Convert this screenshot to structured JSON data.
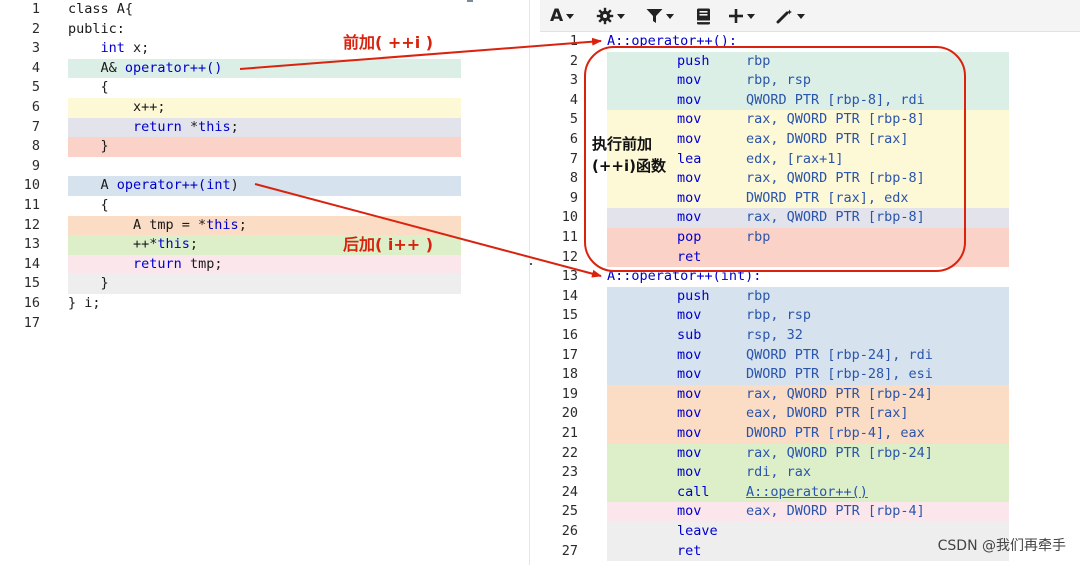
{
  "source": {
    "lines": [
      {
        "n": "1",
        "band": "",
        "segs": [
          {
            "t": "class A{",
            "kw": false
          }
        ]
      },
      {
        "n": "2",
        "band": "",
        "segs": [
          {
            "t": "public:",
            "kw": false
          }
        ]
      },
      {
        "n": "3",
        "band": "",
        "segs": [
          {
            "t": "    ",
            "kw": false
          },
          {
            "t": "int",
            "kw": true
          },
          {
            "t": " x;",
            "kw": false
          }
        ]
      },
      {
        "n": "4",
        "band": "#dcefe6",
        "segs": [
          {
            "t": "    A& ",
            "kw": false
          },
          {
            "t": "operator++()",
            "kw": true
          }
        ]
      },
      {
        "n": "5",
        "band": "",
        "segs": [
          {
            "t": "    {",
            "kw": false
          }
        ]
      },
      {
        "n": "6",
        "band": "#fdf8d6",
        "segs": [
          {
            "t": "        x++;",
            "kw": false
          }
        ]
      },
      {
        "n": "7",
        "band": "#e3e3ec",
        "segs": [
          {
            "t": "        ",
            "kw": false
          },
          {
            "t": "return",
            "kw": true
          },
          {
            "t": " *",
            "kw": false
          },
          {
            "t": "this",
            "kw": true
          },
          {
            "t": ";",
            "kw": false
          }
        ]
      },
      {
        "n": "8",
        "band": "#fbd2c8",
        "segs": [
          {
            "t": "    }",
            "kw": false
          }
        ]
      },
      {
        "n": "9",
        "band": "",
        "segs": []
      },
      {
        "n": "10",
        "band": "#d6e2ee",
        "segs": [
          {
            "t": "    A ",
            "kw": false
          },
          {
            "t": "operator++(",
            "kw": true
          },
          {
            "t": "int",
            "kw": true
          },
          {
            "t": ")",
            "kw": false
          }
        ]
      },
      {
        "n": "11",
        "band": "",
        "segs": [
          {
            "t": "    {",
            "kw": false
          }
        ]
      },
      {
        "n": "12",
        "band": "#fbdcc4",
        "segs": [
          {
            "t": "        A tmp = *",
            "kw": false
          },
          {
            "t": "this",
            "kw": true
          },
          {
            "t": ";",
            "kw": false
          }
        ]
      },
      {
        "n": "13",
        "band": "#dcefc9",
        "segs": [
          {
            "t": "        ++*",
            "kw": false
          },
          {
            "t": "this",
            "kw": true
          },
          {
            "t": ";",
            "kw": false
          }
        ]
      },
      {
        "n": "14",
        "band": "#fbe6ec",
        "segs": [
          {
            "t": "        ",
            "kw": false
          },
          {
            "t": "return",
            "kw": true
          },
          {
            "t": " tmp;",
            "kw": false
          }
        ]
      },
      {
        "n": "15",
        "band": "#eeeeee",
        "segs": [
          {
            "t": "    }",
            "kw": false
          }
        ]
      },
      {
        "n": "16",
        "band": "",
        "segs": [
          {
            "t": "} i;",
            "kw": false
          }
        ]
      },
      {
        "n": "17",
        "band": "",
        "segs": []
      }
    ]
  },
  "toolbar": {
    "font_label": "A"
  },
  "assembly": {
    "lines": [
      {
        "n": "1",
        "band": "",
        "label": "A::operator++():",
        "op": "",
        "arg": ""
      },
      {
        "n": "2",
        "band": "#dcefe6",
        "label": "",
        "op": "push",
        "arg": "rbp"
      },
      {
        "n": "3",
        "band": "#dcefe6",
        "label": "",
        "op": "mov",
        "arg": "rbp, rsp"
      },
      {
        "n": "4",
        "band": "#dcefe6",
        "label": "",
        "op": "mov",
        "arg": "QWORD PTR [rbp-8], rdi"
      },
      {
        "n": "5",
        "band": "#fdf8d6",
        "label": "",
        "op": "mov",
        "arg": "rax, QWORD PTR [rbp-8]"
      },
      {
        "n": "6",
        "band": "#fdf8d6",
        "label": "",
        "op": "mov",
        "arg": "eax, DWORD PTR [rax]"
      },
      {
        "n": "7",
        "band": "#fdf8d6",
        "label": "",
        "op": "lea",
        "arg": "edx, [rax+1]"
      },
      {
        "n": "8",
        "band": "#fdf8d6",
        "label": "",
        "op": "mov",
        "arg": "rax, QWORD PTR [rbp-8]"
      },
      {
        "n": "9",
        "band": "#fdf8d6",
        "label": "",
        "op": "mov",
        "arg": "DWORD PTR [rax], edx"
      },
      {
        "n": "10",
        "band": "#e3e3ec",
        "label": "",
        "op": "mov",
        "arg": "rax, QWORD PTR [rbp-8]"
      },
      {
        "n": "11",
        "band": "#fbd2c8",
        "label": "",
        "op": "pop",
        "arg": "rbp"
      },
      {
        "n": "12",
        "band": "#fbd2c8",
        "label": "",
        "op": "ret",
        "arg": ""
      },
      {
        "n": "13",
        "band": "",
        "label": "A::operator++(int):",
        "op": "",
        "arg": ""
      },
      {
        "n": "14",
        "band": "#d6e2ee",
        "label": "",
        "op": "push",
        "arg": "rbp"
      },
      {
        "n": "15",
        "band": "#d6e2ee",
        "label": "",
        "op": "mov",
        "arg": "rbp, rsp"
      },
      {
        "n": "16",
        "band": "#d6e2ee",
        "label": "",
        "op": "sub",
        "arg": "rsp, 32"
      },
      {
        "n": "17",
        "band": "#d6e2ee",
        "label": "",
        "op": "mov",
        "arg": "QWORD PTR [rbp-24], rdi"
      },
      {
        "n": "18",
        "band": "#d6e2ee",
        "label": "",
        "op": "mov",
        "arg": "DWORD PTR [rbp-28], esi"
      },
      {
        "n": "19",
        "band": "#fbdcc4",
        "label": "",
        "op": "mov",
        "arg": "rax, QWORD PTR [rbp-24]"
      },
      {
        "n": "20",
        "band": "#fbdcc4",
        "label": "",
        "op": "mov",
        "arg": "eax, DWORD PTR [rax]"
      },
      {
        "n": "21",
        "band": "#fbdcc4",
        "label": "",
        "op": "mov",
        "arg": "DWORD PTR [rbp-4], eax"
      },
      {
        "n": "22",
        "band": "#dcefc9",
        "label": "",
        "op": "mov",
        "arg": "rax, QWORD PTR [rbp-24]"
      },
      {
        "n": "23",
        "band": "#dcefc9",
        "label": "",
        "op": "mov",
        "arg": "rdi, rax"
      },
      {
        "n": "24",
        "band": "#dcefc9",
        "label": "",
        "op": "call",
        "arg": "A::operator++()",
        "link": true
      },
      {
        "n": "25",
        "band": "#fbe6ec",
        "label": "",
        "op": "mov",
        "arg": "eax, DWORD PTR [rbp-4]"
      },
      {
        "n": "26",
        "band": "#eeeeee",
        "label": "",
        "op": "leave",
        "arg": ""
      },
      {
        "n": "27",
        "band": "#eeeeee",
        "label": "",
        "op": "ret",
        "arg": ""
      }
    ]
  },
  "annotations": {
    "pre_increment": "前加( ++i )",
    "post_increment": "后加( i++ )",
    "callout": "执行前加\n(++i)函数",
    "accent_color": "#d9230f"
  },
  "watermark": "CSDN @我们再牵手"
}
